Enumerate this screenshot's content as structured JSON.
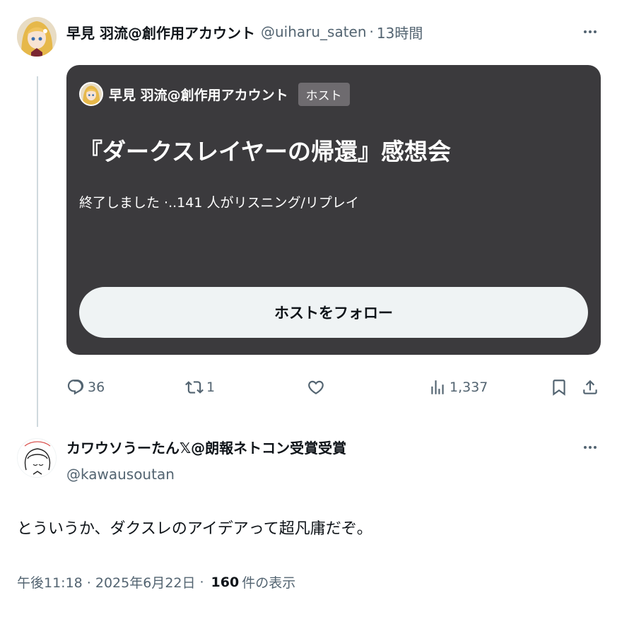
{
  "tweet": {
    "display_name": "早見 羽流@創作用アカウント",
    "handle": "@uiharu_saten",
    "separator": "·",
    "time": "13時間"
  },
  "space_card": {
    "host_name": "早見 羽流@創作用アカウント",
    "host_badge": "ホスト",
    "title": "『ダークスレイヤーの帰還』感想会",
    "status": "終了しました ·..141 人がリスニング/リプレイ",
    "follow_button": "ホストをフォロー"
  },
  "actions": {
    "replies": "36",
    "reposts": "1",
    "likes": "",
    "views": "1,337"
  },
  "reply": {
    "display_name": "カワウソうーたん𝕏@朗報ネトコン受賞受賞",
    "handle": "@kawausoutan",
    "text": "とういうか、ダクスレのアイデアって超凡庸だぞ。",
    "timestamp": "午後11:18 · 2025年6月22日",
    "separator": "·",
    "views_count": "160",
    "views_label": "件の表示"
  },
  "colors": {
    "text_primary": "#0f1419",
    "text_secondary": "#536471",
    "card_bg": "#3b3a3d",
    "button_bg": "#eff3f4",
    "thread_line": "#cfd9de"
  },
  "icons": {
    "reply": "reply-icon",
    "repost": "repost-icon",
    "like": "heart-icon",
    "views": "analytics-icon",
    "bookmark": "bookmark-icon",
    "share": "share-icon",
    "more": "more-icon"
  }
}
